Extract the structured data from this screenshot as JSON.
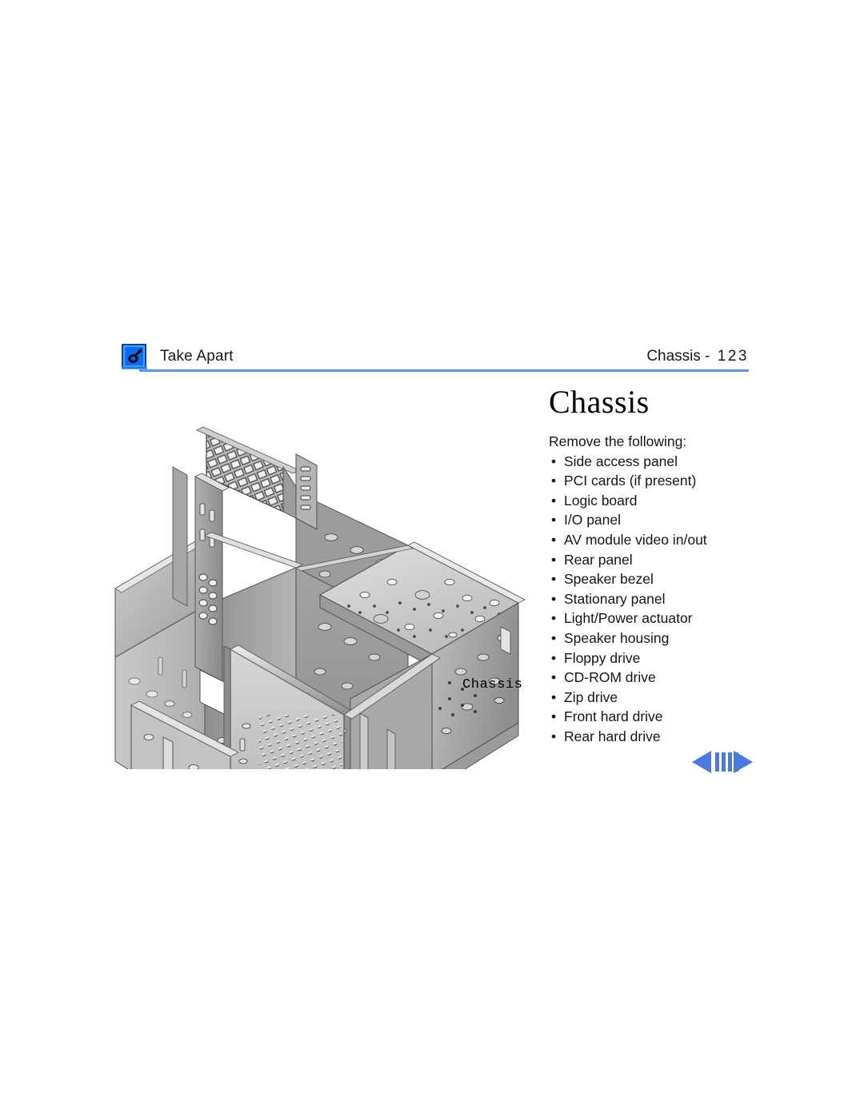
{
  "header": {
    "icon_name": "take-apart-tool-icon",
    "left_label": "Take Apart",
    "right_label_text": "Chassis - ",
    "right_label_page": "123",
    "rule_color": "#5e93f7"
  },
  "section": {
    "title": "Chassis"
  },
  "content": {
    "intro": "Remove the following:",
    "bullet_glyph": "•",
    "items": [
      "Side access panel",
      "PCI cards (if present)",
      "Logic board",
      "I/O panel",
      "AV module video in/out",
      "Rear panel",
      "Speaker bezel",
      "Stationary panel",
      "Light/Power actuator",
      "Speaker housing",
      "Floppy drive",
      "CD-ROM drive",
      "Zip drive",
      "Front hard drive",
      "Rear hard drive"
    ]
  },
  "illustration": {
    "alt": "Isometric photograph of an open metal computer chassis frame",
    "callout_label": "Chassis"
  },
  "navigation": {
    "prev_name": "previous-page-arrow",
    "next_name": "next-page-arrow",
    "bars_name": "page-marker-bars",
    "color": "#4a7ae0"
  }
}
